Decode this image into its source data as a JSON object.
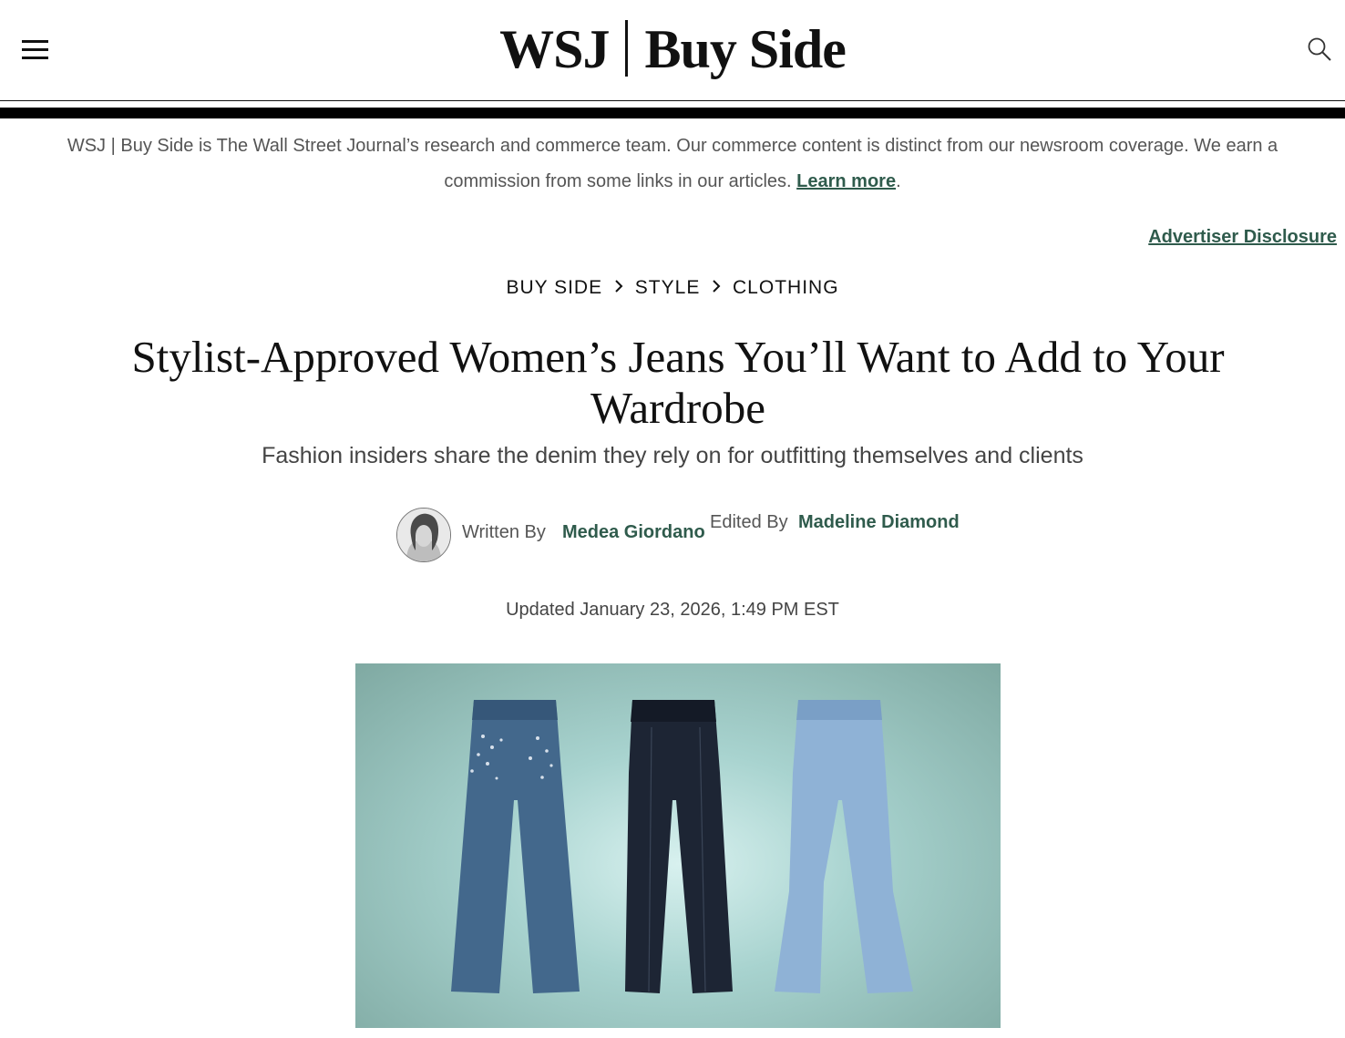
{
  "header": {
    "logo_left": "WSJ",
    "logo_right": "Buy Side",
    "menu_icon": "hamburger-menu-icon",
    "search_icon": "search-icon"
  },
  "disclaimer": {
    "text": "WSJ | Buy Side is The Wall Street Journal’s research and commerce team. Our commerce content is distinct from our newsroom coverage. We earn a commission from some links in our articles.",
    "link_label": "Learn more",
    "trailing": "."
  },
  "advertiser_disclosure": "Advertiser Disclosure",
  "breadcrumbs": [
    "BUY SIDE",
    "STYLE",
    "CLOTHING"
  ],
  "article": {
    "title": "Stylist-Approved Women’s Jeans You’ll Want to Add to Your Wardrobe",
    "dek": "Fashion insiders share the denim they rely on for outfitting themselves and clients",
    "written_by_label": "Written By",
    "author": "Medea Giordano",
    "edited_by_label": "Edited By",
    "editor": "Madeline Diamond",
    "updated": "Updated January 23, 2026, 1:49 PM EST"
  },
  "colors": {
    "link": "#2f5b4c",
    "rule": "#000000",
    "hero_bg": "#a8d3cf"
  }
}
